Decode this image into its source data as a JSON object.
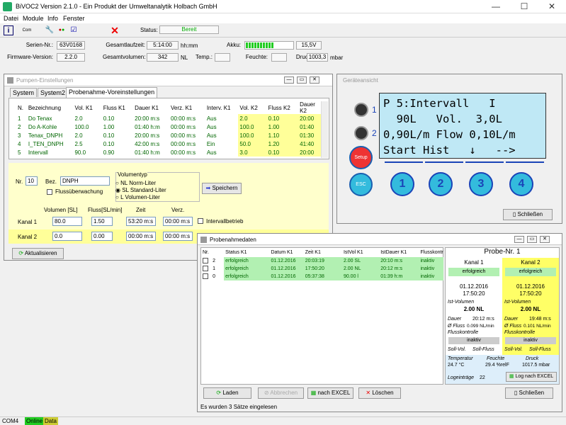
{
  "window": {
    "title": "BiVOC2 Version 2.1.0 - Ein Produkt der Umweltanalytik Holbach GmbH"
  },
  "menu": [
    "Datei",
    "Module",
    "Info",
    "Fenster"
  ],
  "toolbar": {
    "status_label": "Status:",
    "status_value": "Bereit"
  },
  "info": {
    "serien_label": "Serien-Nr.:",
    "serien_value": "63V0168",
    "firmware_label": "Firmware-Version:",
    "firmware_value": "2.2.0",
    "laufzeit_label": "Gesamtlaufzeit:",
    "laufzeit_value": "5:14:00",
    "laufzeit_unit": "hh:mm",
    "volumen_label": "Gesamtvolumen:",
    "volumen_value": "342",
    "volumen_unit": "NL",
    "akku_label": "Akku:",
    "akku_value": "15,5V",
    "akku_level": 0.6,
    "temp_label": "Temp.:",
    "feuchte_label": "Feuchte:",
    "druck_label": "Druck:",
    "druck_value": "1003,3",
    "druck_unit": "mbar"
  },
  "pumpen": {
    "title": "Pumpen-Einstellungen",
    "tabs": [
      "System",
      "System2",
      "Probenahme-Voreinstellungen"
    ],
    "headers": [
      "N.",
      "Bezeichnung",
      "Vol. K1",
      "Fluss K1",
      "Dauer K1",
      "Verz. K1",
      "Interv. K1",
      "Vol. K2",
      "Fluss K2",
      "Dauer K2"
    ],
    "rows": [
      [
        "1",
        "Do Tenax",
        "2.0",
        "0.10",
        "20:00 m:s",
        "00:00 m:s",
        "Aus",
        "2.0",
        "0.10",
        "20:00"
      ],
      [
        "2",
        "Do A-Kohle",
        "100.0",
        "1.00",
        "01:40 h:m",
        "00:00 m:s",
        "Aus",
        "100.0",
        "1.00",
        "01:40"
      ],
      [
        "3",
        "Tenax_DNPH",
        "2.0",
        "0.10",
        "20:00 m:s",
        "00:00 m:s",
        "Aus",
        "100.0",
        "1.10",
        "01:30"
      ],
      [
        "4",
        "I_TEN_DNPH",
        "2.5",
        "0.10",
        "42:00 m:s",
        "00:00 m:s",
        "Ein",
        "50.0",
        "1.20",
        "41:40"
      ],
      [
        "5",
        "Intervall",
        "90.0",
        "0.90",
        "01:40 h:m",
        "00:00 m:s",
        "Aus",
        "3.0",
        "0.10",
        "20:00"
      ]
    ],
    "nr_label": "Nr.",
    "nr_value": "10",
    "bez_label": "Bez.",
    "bez_value": "DNPH",
    "fluss_label": "Flussüberwachung",
    "volumentyp_label": "Volumentyp",
    "volumentyp_options": [
      "NL Norm-Liter",
      "SL Standard-Liter",
      "L  Volumen-Liter"
    ],
    "speichern": "Speichern",
    "col_labels": [
      "Volumen [SL]",
      "Fluss[SL/min]",
      "Zeit",
      "Verz."
    ],
    "kanal1_label": "Kanal 1",
    "kanal1": [
      "80.0",
      "1.50",
      "53:20 m:s",
      "00:00 m:s"
    ],
    "kanal2_label": "Kanal 2",
    "kanal2": [
      "0.0",
      "0.00",
      "00:00 m:s",
      "00:00 m:s"
    ],
    "intervall_label": "Intervallbetrieb",
    "aktualisieren": "Aktualisieren"
  },
  "geraet": {
    "title": "Geräteansicht",
    "lcd": [
      "P 5:Intervall   I",
      "  90L   Vol.  3,0L",
      "0,90L/m Flow 0,10L/m",
      "Start Hist   ↓   -->"
    ],
    "led1": "1",
    "led2": "2",
    "setup": "Setup",
    "esc": "ESC",
    "keys": [
      "1",
      "2",
      "3",
      "4"
    ],
    "schliessen": "Schließen"
  },
  "probe": {
    "title": "Probenahmedaten",
    "headers": [
      "Nr.",
      "Status K1",
      "Datum K1",
      "Zeit K1",
      "IstVol K1",
      "IstDauer K1",
      "Flusskontr"
    ],
    "rows": [
      [
        "2",
        "erfolgreich",
        "01.12.2016",
        "20:03:19",
        "2.00 SL",
        "20:10 m:s",
        "inaktiv"
      ],
      [
        "1",
        "erfolgreich",
        "01.12.2016",
        "17:50:20",
        "2.00 NL",
        "20:12 m:s",
        "inaktiv"
      ],
      [
        "0",
        "erfolgreich",
        "01.12.2016",
        "05:37:38",
        "90.00 l",
        "01:39 h:m",
        "inaktiv"
      ]
    ],
    "probe_nr": "Probe-Nr. 1",
    "k1": {
      "label": "Kanal 1",
      "status": "erfolgreich",
      "datum": "01.12.2016",
      "zeit": "17:50:20",
      "ist_label": "Ist-Volumen",
      "ist": "2.00 NL",
      "dauer_label": "Dauer",
      "dauer": "20:12 m:s",
      "fluss_label": "Ø Fluss",
      "fluss": "0.099 NL/min",
      "kontrolle_label": "Flusskontrolle",
      "kontrolle": "inaktiv",
      "soll_vol": "Soll-Vol.",
      "soll_fluss": "Soll-Fluss"
    },
    "k2": {
      "label": "Kanal 2",
      "status": "erfolgreich",
      "datum": "01.12.2016",
      "zeit": "17:50:20",
      "ist_label": "Ist-Volumen",
      "ist": "2.00 NL",
      "dauer_label": "Dauer",
      "dauer": "19:48 m:s",
      "fluss_label": "Ø Fluss",
      "fluss": "0.101 NL/min",
      "kontrolle_label": "Flusskontrolle",
      "kontrolle": "inaktiv",
      "soll_vol": "Soll-Vol.",
      "soll_fluss": "Soll-Fluss"
    },
    "env": {
      "temp_label": "Temperatur",
      "temp": "24.7 °C",
      "feuchte_label": "Feuchte",
      "feuchte": "29.4 %relF",
      "druck_label": "Druck",
      "druck": "1017.5 mbar"
    },
    "log_label": "Logeinträge",
    "log_count": "22",
    "log_btn": "Log nach EXCEL",
    "buttons": [
      "Laden",
      "Abbrechen",
      "nach EXCEL",
      "Löschen",
      "Schließen"
    ],
    "status": "Es wurden 3 Sätze eingelesen"
  },
  "statusbar": {
    "port": "COM4",
    "online": "Online",
    "data": "Data"
  }
}
